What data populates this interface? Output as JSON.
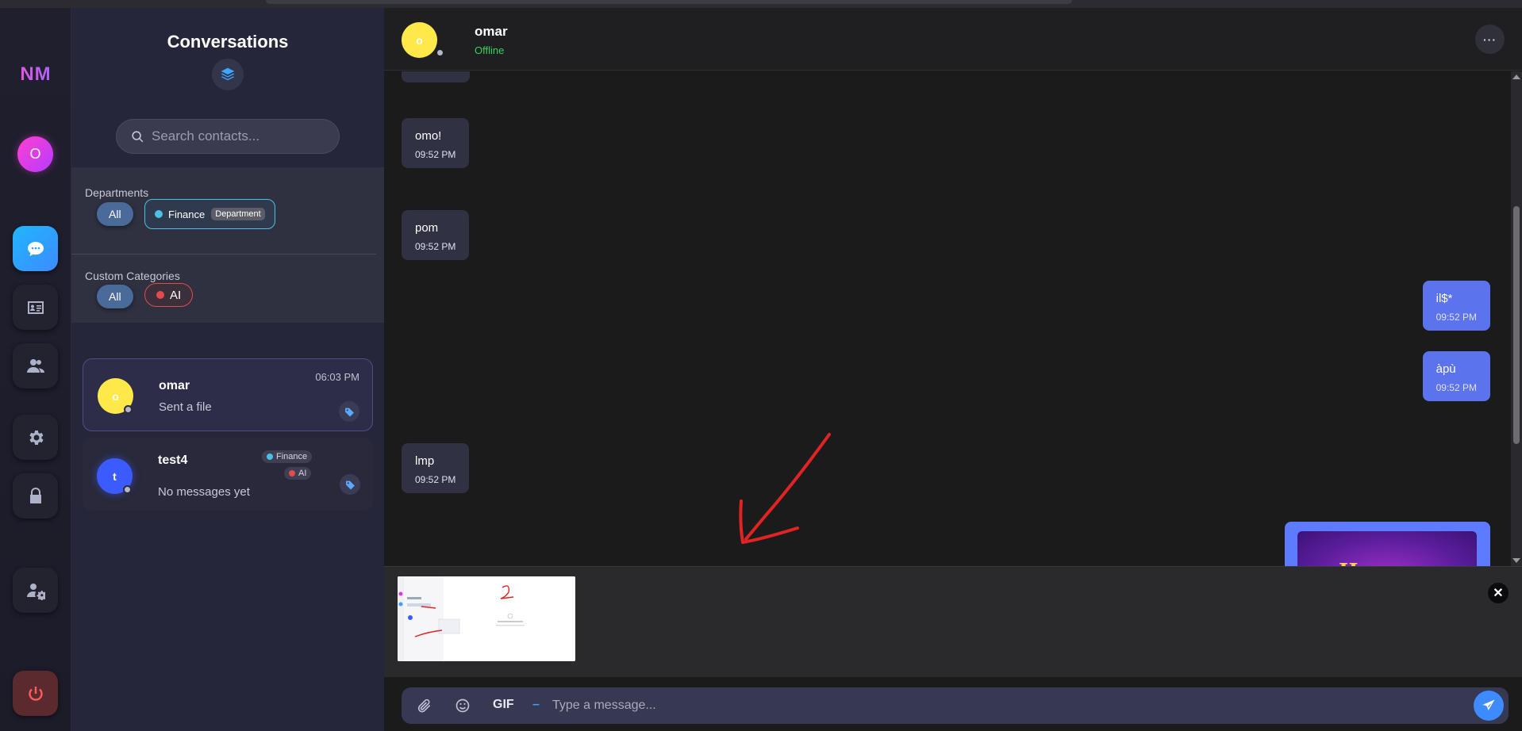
{
  "rail": {
    "logo": "NM",
    "avatar_initial": "O",
    "icons": [
      "chat-icon",
      "contact-card-icon",
      "users-icon",
      "gear-icon",
      "lock-icon",
      "user-settings-icon",
      "power-icon"
    ]
  },
  "conversations": {
    "title": "Conversations",
    "search_placeholder": "Search contacts...",
    "departments_label": "Departments",
    "departments": [
      {
        "label": "All",
        "active": true
      },
      {
        "label": "Finance",
        "tag": "Department",
        "dot_color": "#4bc0e6"
      }
    ],
    "categories_label": "Custom Categories",
    "categories": [
      {
        "label": "All",
        "active": true
      },
      {
        "label": "AI",
        "dot_color": "#e24b4b"
      }
    ],
    "items": [
      {
        "name": "omar",
        "initial": "o",
        "preview": "Sent a file",
        "time": "06:03 PM",
        "avatar_color": "#ffe94a",
        "selected": true,
        "tags": []
      },
      {
        "name": "test4",
        "initial": "t",
        "preview": "No messages yet",
        "time": "",
        "avatar_color": "#3b5bff",
        "selected": false,
        "tags": [
          "Finance",
          "AI"
        ]
      }
    ]
  },
  "chat": {
    "contact_name": "omar",
    "contact_initial": "o",
    "status": "Offline",
    "more_label": "···",
    "messages": [
      {
        "dir": "in",
        "text": "omo!",
        "time": "09:52 PM"
      },
      {
        "dir": "in",
        "text": "pom",
        "time": "09:52 PM"
      },
      {
        "dir": "out",
        "text": "il$*",
        "time": "09:52 PM"
      },
      {
        "dir": "out",
        "text": "àpù",
        "time": "09:52 PM"
      },
      {
        "dir": "in",
        "text": "lmp",
        "time": "09:52 PM"
      }
    ],
    "image_message_text": "Happy",
    "composer": {
      "gif_label": "GIF",
      "dash_label": "–",
      "placeholder": "Type a message..."
    },
    "attachment_close": "✕"
  },
  "colors": {
    "accent": "#3e8bff",
    "outgoing_bubble": "#5b73ec",
    "incoming_bubble": "#303142",
    "online_green": "#35d35c",
    "annotation_red": "#e02424"
  }
}
